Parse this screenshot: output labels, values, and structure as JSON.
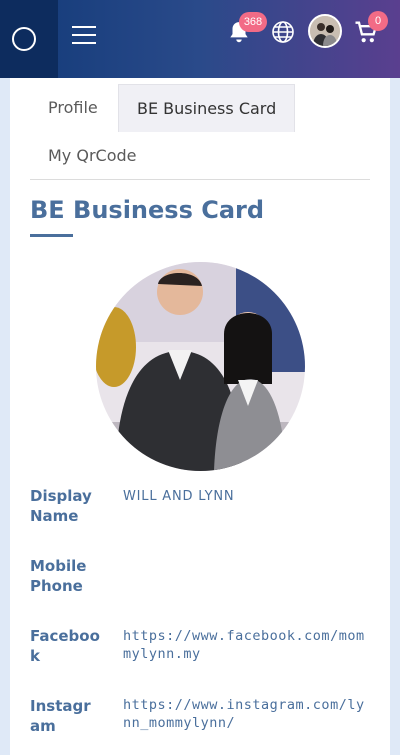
{
  "header": {
    "notification_count": "368",
    "cart_count": "0",
    "colors": {
      "start": "#123a78",
      "end": "#5a3f8f",
      "badge": "#f26b86"
    }
  },
  "tabs": [
    {
      "label": "Profile",
      "active": false
    },
    {
      "label": "BE Business Card",
      "active": true
    },
    {
      "label": "My QrCode",
      "active": false
    }
  ],
  "section": {
    "title": "BE Business Card"
  },
  "fields": [
    {
      "label": "Display Name",
      "value": "WILL AND LYNN"
    },
    {
      "label": "Mobile Phone",
      "value": ""
    },
    {
      "label": "Facebook",
      "value": "https://www.facebook.com/mommylynn.my"
    },
    {
      "label": "Instagram",
      "value": "https://www.instagram.com/lynn_mommylynn/"
    }
  ],
  "icons": [
    "logo-icon",
    "hamburger-menu-icon",
    "bell-icon",
    "globe-icon",
    "avatar",
    "cart-icon"
  ]
}
